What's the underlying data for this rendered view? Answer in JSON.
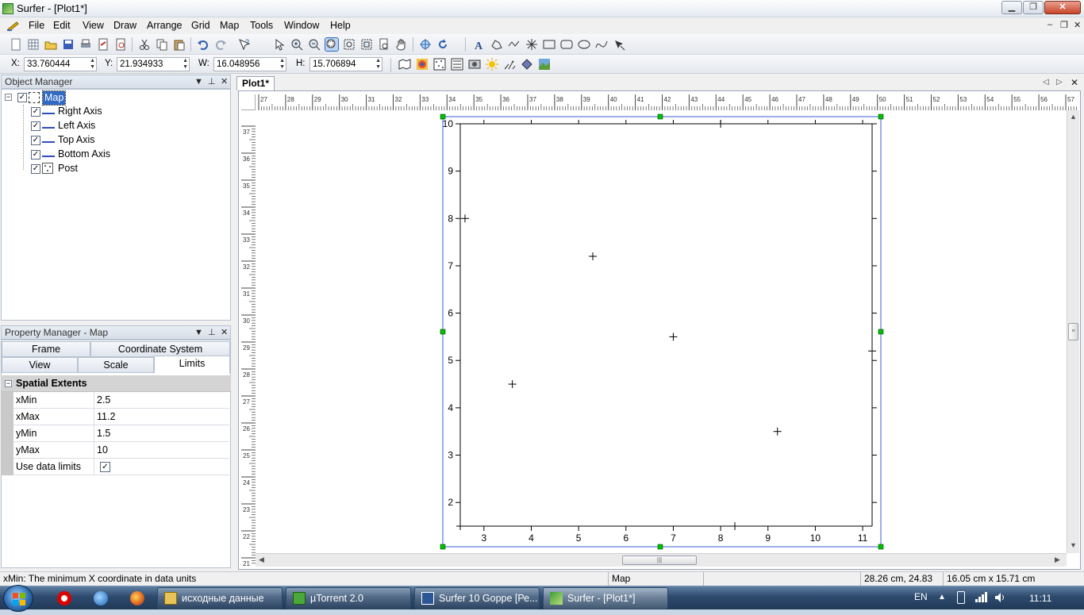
{
  "window": {
    "title": "Surfer - [Plot1*]"
  },
  "menu": [
    "File",
    "Edit",
    "View",
    "Draw",
    "Arrange",
    "Grid",
    "Map",
    "Tools",
    "Window",
    "Help"
  ],
  "coords": {
    "x_label": "X:",
    "x_value": "33.760444",
    "y_label": "Y:",
    "y_value": "21.934933",
    "w_label": "W:",
    "w_value": "16.048956",
    "h_label": "H:",
    "h_value": "15.706894"
  },
  "object_manager": {
    "title": "Object Manager",
    "root": "Map",
    "items": [
      "Right Axis",
      "Left Axis",
      "Top Axis",
      "Bottom Axis",
      "Post"
    ]
  },
  "property_manager": {
    "title": "Property Manager - Map",
    "tabs_row1": [
      "Frame",
      "Coordinate System"
    ],
    "tabs_row2": [
      "View",
      "Scale",
      "Limits"
    ],
    "active_tab": "Limits",
    "section": "Spatial Extents",
    "rows": [
      {
        "name": "xMin",
        "value": "2.5"
      },
      {
        "name": "xMax",
        "value": "11.2"
      },
      {
        "name": "yMin",
        "value": "1.5"
      },
      {
        "name": "yMax",
        "value": "10"
      },
      {
        "name": "Use data limits",
        "value": "✓"
      }
    ]
  },
  "document": {
    "tab": "Plot1*"
  },
  "ruler": {
    "h_labels": [
      "27",
      "28",
      "29",
      "30",
      "31",
      "32",
      "33",
      "34",
      "35",
      "36",
      "37",
      "38",
      "39",
      "40",
      "41",
      "42",
      "43",
      "44",
      "45",
      "46",
      "47",
      "48",
      "49",
      "50",
      "51",
      "52",
      "53",
      "54",
      "55",
      "56",
      "57"
    ],
    "v_labels": [
      "37",
      "36",
      "35",
      "34",
      "33",
      "32",
      "31",
      "30",
      "29",
      "28",
      "27",
      "26",
      "25",
      "24",
      "23",
      "22",
      "21"
    ]
  },
  "chart_data": {
    "type": "scatter",
    "title": "",
    "xlabel": "",
    "ylabel": "",
    "xlim": [
      2.5,
      11.2
    ],
    "ylim": [
      1.5,
      10
    ],
    "x_ticks": [
      "3",
      "4",
      "5",
      "6",
      "7",
      "8",
      "9",
      "10",
      "11"
    ],
    "y_ticks": [
      "2",
      "3",
      "4",
      "5",
      "6",
      "7",
      "8",
      "9",
      "10"
    ],
    "points": [
      {
        "x": 2.6,
        "y": 8.0
      },
      {
        "x": 5.3,
        "y": 7.2
      },
      {
        "x": 7.0,
        "y": 5.5
      },
      {
        "x": 3.6,
        "y": 4.5
      },
      {
        "x": 9.2,
        "y": 3.5
      },
      {
        "x": 8.0,
        "y": 10.0
      },
      {
        "x": 11.2,
        "y": 5.2
      },
      {
        "x": 8.3,
        "y": 1.5
      },
      {
        "x": 2.5,
        "y": 1.5
      }
    ],
    "grid": false
  },
  "status": {
    "hint": "xMin: The minimum X coordinate in data units",
    "selection": "Map",
    "position": "28.26 cm, 24.83 cm",
    "size": "16.05 cm x 15.71 cm"
  },
  "taskbar": {
    "tasks": [
      "исходные данные",
      "µTorrent 2.0",
      "Surfer 10 Goppe [Ре...",
      "Surfer - [Plot1*]"
    ],
    "lang": "EN",
    "time": "11:11"
  },
  "colors": {
    "accent": "#316ac5",
    "handle": "#00c000",
    "frame": "#3b5bdb"
  }
}
